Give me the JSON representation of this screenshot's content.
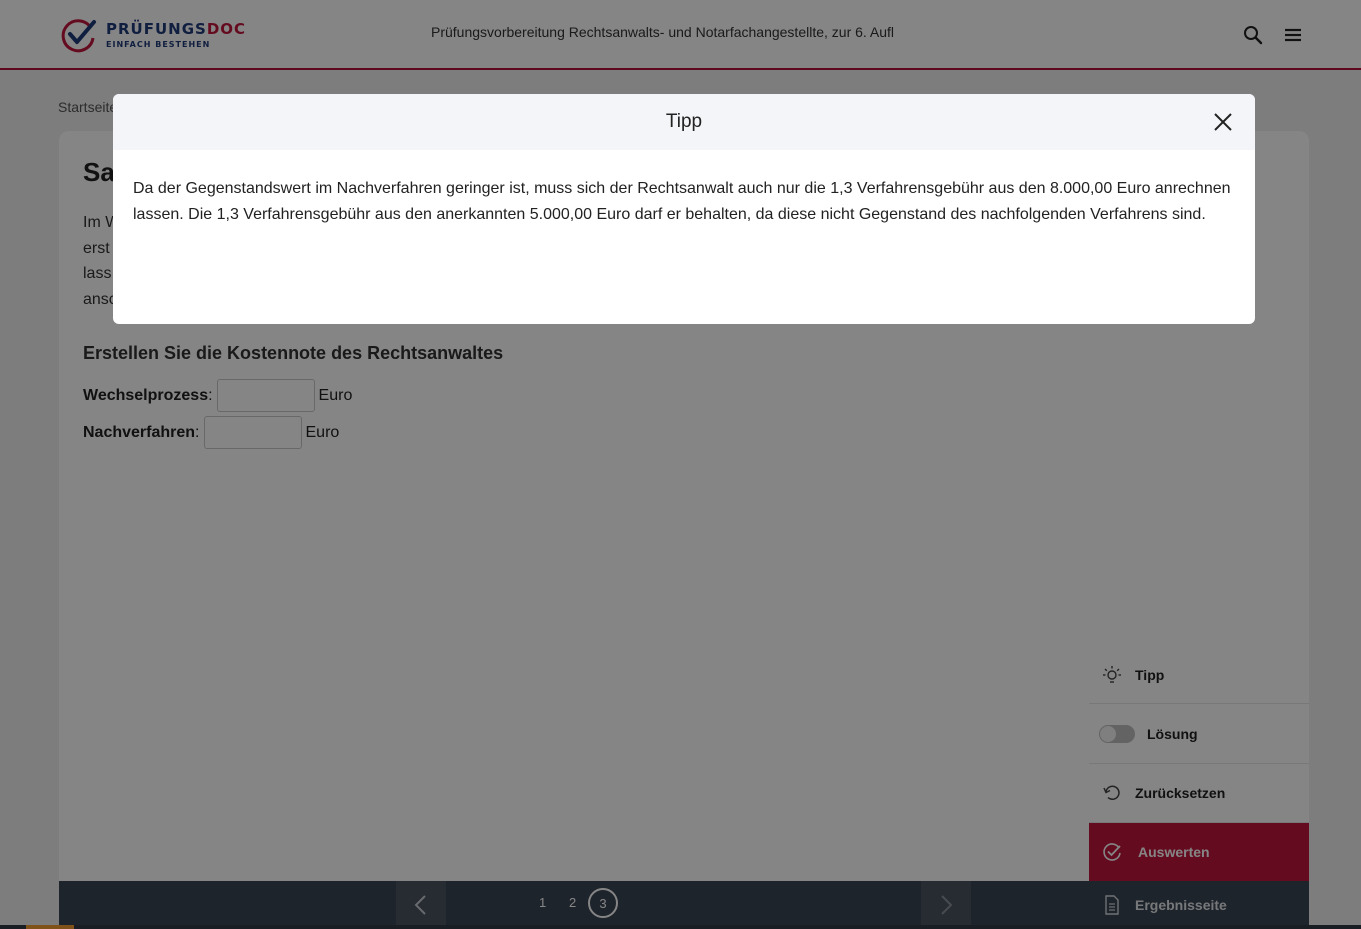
{
  "header": {
    "logo_title_main": "PRÜFUNGS",
    "logo_title_accent": "DOC",
    "logo_subtitle": "EINFACH BESTEHEN",
    "title": "Prüfungsvorbereitung Rechtsanwalts- und Notarfachangestellte, zur 6. Aufl",
    "search_icon": "search-icon",
    "menu_icon": "hamburger-menu-icon"
  },
  "breadcrumb": "Startseite",
  "page": {
    "title": "Sa",
    "intro_lines": [
      "Im W",
      "erst",
      "lass",
      "ansc"
    ],
    "task_heading": "Erstellen Sie die Kostennote des Rechtsanwaltes",
    "fields": [
      {
        "label": "Wechselprozess",
        "value": "",
        "unit": "Euro"
      },
      {
        "label": "Nachverfahren",
        "value": "",
        "unit": "Euro"
      }
    ]
  },
  "pagination": {
    "pages": [
      "1",
      "2",
      "3"
    ],
    "current": "3"
  },
  "side_panel": {
    "tipp": "Tipp",
    "loesung": "Lösung",
    "loesung_enabled": false,
    "zuruecksetzen": "Zurücksetzen",
    "auswerten": "Auswerten",
    "ergebnisseite": "Ergebnisseite"
  },
  "modal": {
    "title": "Tipp",
    "body": "Da der Gegenstandswert im Nachverfahren geringer ist, muss sich der Rechtsanwalt auch nur die 1,3 Verfahrensgebühr aus den 8.000,00 Euro anrechnen lassen. Die 1,3 Verfahrensgebühr aus den anerkannten 5.000,00 Euro darf er behalten, da diese nicht Gegenstand des nachfolgenden Verfahrens sind."
  },
  "colors": {
    "brand_red": "#c2163f",
    "brand_blue": "#1f3a7a",
    "nav_dark": "#3a4553",
    "accent_orange": "#f29e2e"
  }
}
